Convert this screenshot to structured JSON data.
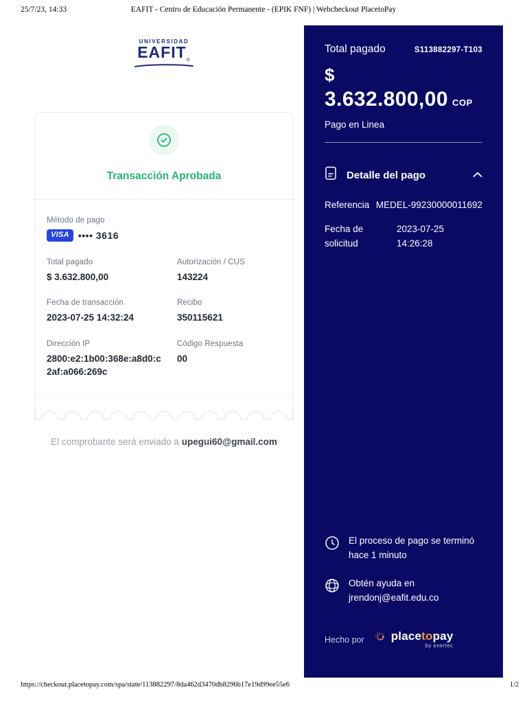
{
  "print": {
    "datetime": "25/7/23, 14:33",
    "title": "EAFIT - Centro de Educación Permanente - (EPIK FNF) | Webcheckout PlacetoPay",
    "url": "https://checkout.placetopay.com/spa/state/113882297/8da462d3470db8296b17e19d99ee55e6",
    "page_indicator": "1/2"
  },
  "logo": {
    "top": "UNIVERSIDAD",
    "name": "EAFIT",
    "reg": "®"
  },
  "receipt": {
    "status_title": "Transacción Aprobada",
    "payment_method_label": "Método de pago",
    "card_brand": "VISA",
    "card_mask": "•••• 3616",
    "total_label": "Total pagado",
    "total_value": "$ 3.632.800,00",
    "auth_label": "Autorización / CUS",
    "auth_value": "143224",
    "date_label": "Fecha de transacción",
    "date_value": "2023-07-25 14:32:24",
    "receipt_label": "Recibo",
    "receipt_value": "350115621",
    "ip_label": "Dirección IP",
    "ip_value": "2800:e2:1b00:368e:a8d0:c2af:a066:269c",
    "code_label": "Código Respuesta",
    "code_value": "00",
    "email_prefix": "El comprobante será enviado a ",
    "email": "upegui60@gmail.com"
  },
  "sidebar": {
    "total_label": "Total pagado",
    "transaction_code": "S113882297-T103",
    "currency_symbol": "$",
    "amount": "3.632.800,00",
    "currency": "COP",
    "description": "Pago en Linea",
    "detail_title": "Detalle del pago",
    "reference_label": "Referencia",
    "reference_value": "MEDEL-99230000011692",
    "request_date_label": "Fecha de solicitud",
    "request_date_value": "2023-07-25 14:26:28",
    "process_note": "El proceso de pago se terminó hace 1 minuto",
    "help_label": "Obtén ayuda en",
    "help_email": "jrendonj@eafit.edu.co",
    "made_by_label": "Hecho por",
    "brand_place": "place",
    "brand_to": "to",
    "brand_pay": "pay",
    "brand_by": "by evertec"
  },
  "colors": {
    "sidebar_navy": "#0a0a64",
    "success_green": "#26b473",
    "brand_orange": "#f0923d",
    "visa_blue": "#2546e0",
    "eafit_navy": "#1e2a78"
  }
}
